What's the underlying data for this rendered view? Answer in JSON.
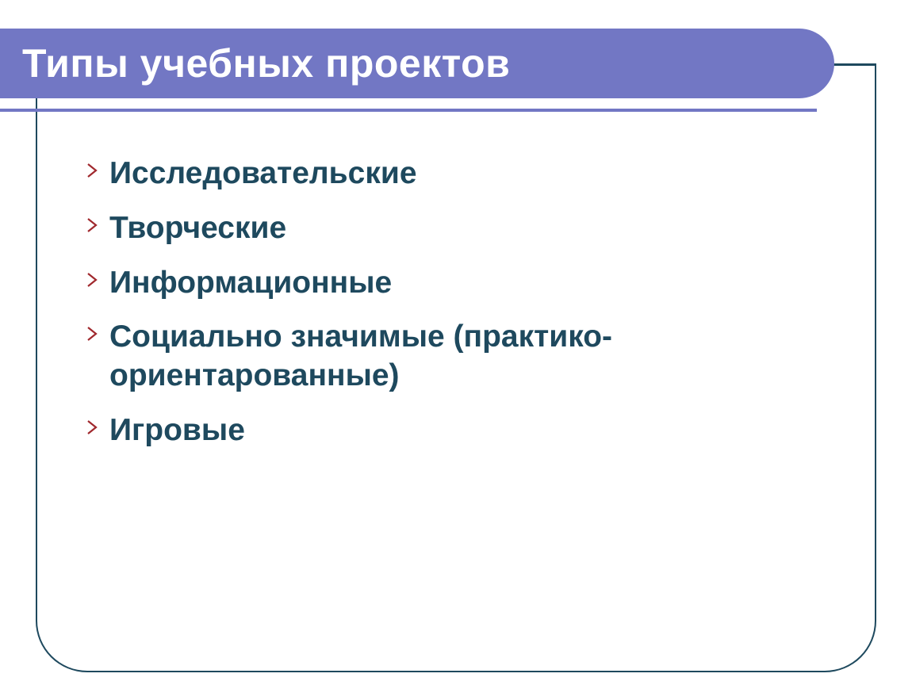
{
  "title": "Типы учебных проектов",
  "items": [
    "Исследовательские",
    "Творческие",
    "Информационные",
    "Социально значимые (практико-ориентарованные)",
    "Игровые"
  ],
  "colors": {
    "banner": "#7277c4",
    "text": "#1e495e",
    "bullet": "#a0282d"
  }
}
